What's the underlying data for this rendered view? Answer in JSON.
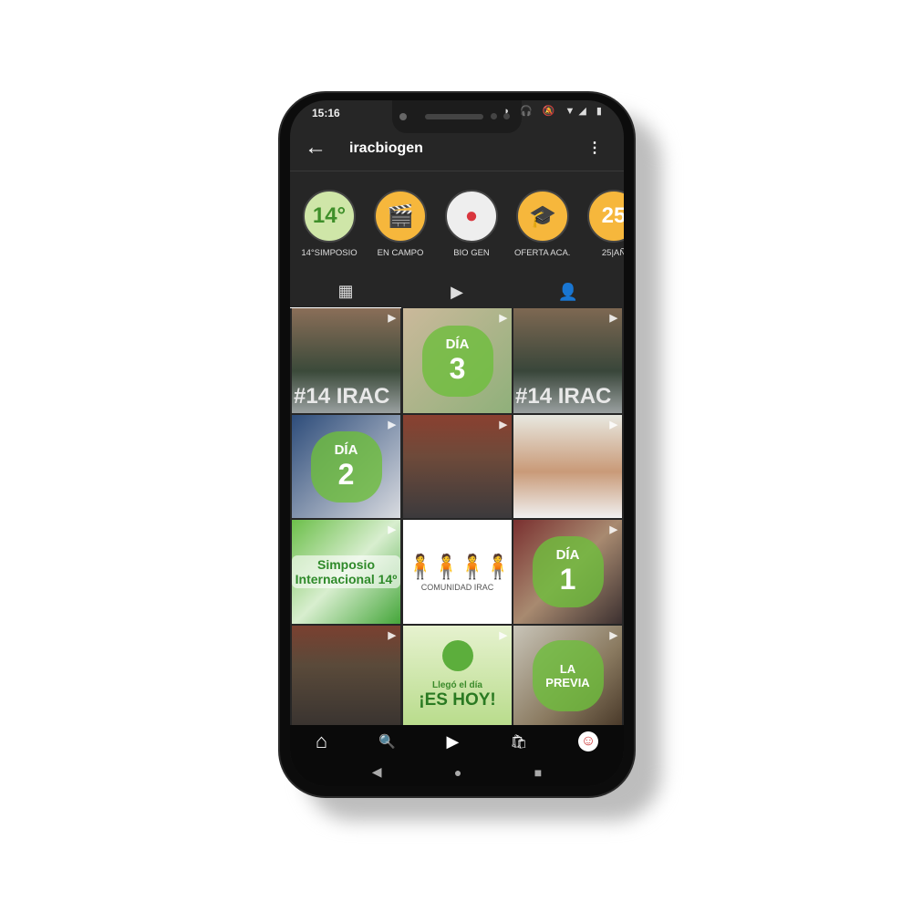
{
  "status": {
    "time": "15:16",
    "icons": "◗ 🎧 🔕 ▼◢ ▮"
  },
  "header": {
    "username": "iracbiogen",
    "back": "←",
    "more": "⋮"
  },
  "highlights": [
    {
      "label": "14°SIMPOSIO",
      "mark": "14°",
      "bg": "#cfe6a8",
      "fg": "#3f8f2a"
    },
    {
      "label": "EN CAMPO",
      "mark": "🎬",
      "bg": "#f6b73c",
      "fg": "#fff"
    },
    {
      "label": "BIO GEN",
      "mark": "●",
      "bg": "#eeeeee",
      "fg": "#d9363e"
    },
    {
      "label": "OFERTA ACA...",
      "mark": "🎓",
      "bg": "#f6b73c",
      "fg": "#fff"
    },
    {
      "label": "25|AÑ",
      "mark": "25",
      "bg": "#f6b73c",
      "fg": "#fff"
    }
  ],
  "tabs": {
    "grid": "▦",
    "reels": "▶",
    "tagged": "👤"
  },
  "posts": [
    {
      "text": "#14 IRAC",
      "sub": "",
      "bg": "linear-gradient(#8a6e58,#3b4a3a 60%,#9aa0a0)"
    },
    {
      "text": "DÍA",
      "sub": "3",
      "bg": "linear-gradient(135deg,#cbb99b,#8fb07a)"
    },
    {
      "text": "#14 IRAC",
      "sub": "",
      "bg": "linear-gradient(#7e6852,#39463a 60%,#9aa0a0)"
    },
    {
      "text": "DÍA",
      "sub": "2",
      "bg": "linear-gradient(135deg,#2d4c7a,#d9dbe0)"
    },
    {
      "text": "",
      "sub": "",
      "bg": "linear-gradient(#8a4030,#6e4a3a 40%,#3c3a3c)"
    },
    {
      "text": "",
      "sub": "",
      "bg": "linear-gradient(#e8e8e0,#c99a78 55%,#f0f0f0)"
    },
    {
      "text": "Simposio Internacional 14º",
      "sub": "",
      "bg": "linear-gradient(135deg,#6cbf4a,#d8eecf 50%,#45a63a)"
    },
    {
      "text": "COMUNIDAD IRAC",
      "sub": "",
      "bg": "#ffffff"
    },
    {
      "text": "DÍA",
      "sub": "1",
      "bg": "linear-gradient(135deg,#7a3030,#a88a70 50%,#3c3030)"
    },
    {
      "text": "",
      "sub": "",
      "bg": "linear-gradient(#7a4030,#5a4a3a 40%,#3a3430)"
    },
    {
      "text": "Llegó el día",
      "sub": "¡ES HOY!",
      "bg": "linear-gradient(#e6f2cf,#b9dc8c)"
    },
    {
      "text": "LA",
      "sub": "PREVIA",
      "bg": "linear-gradient(135deg,#c8c4b8,#8a7a60 60%,#4a3a2a)"
    }
  ],
  "nav": {
    "home": "⌂",
    "search": "🔍",
    "reels": "▶",
    "shop": "🛍",
    "profile": "☺"
  },
  "system": {
    "back": "◀",
    "home": "●",
    "recents": "■"
  }
}
